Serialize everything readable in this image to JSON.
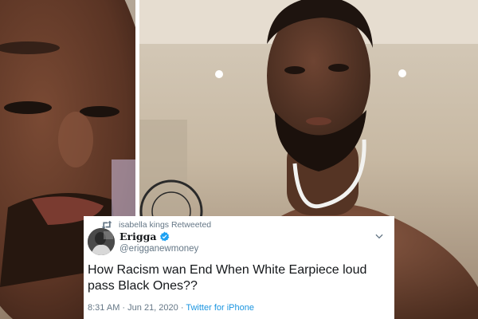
{
  "tweet": {
    "retweet_label": "isabella kings Retweeted",
    "display_name": "Erigga",
    "handle": "@erigganewmoney",
    "text": "How Racism wan End When White Earpiece loud pass Black Ones??",
    "time": "8:31 AM",
    "date": "Jun 21, 2020",
    "separator": "·",
    "source": "Twitter for iPhone"
  },
  "colors": {
    "verified": "#1da1f2",
    "link": "#1b95e0",
    "muted": "#657786",
    "text": "#14171a"
  },
  "icons": {
    "retweet": "retweet-icon",
    "verified": "verified-badge-icon",
    "caret": "chevron-down-icon"
  }
}
